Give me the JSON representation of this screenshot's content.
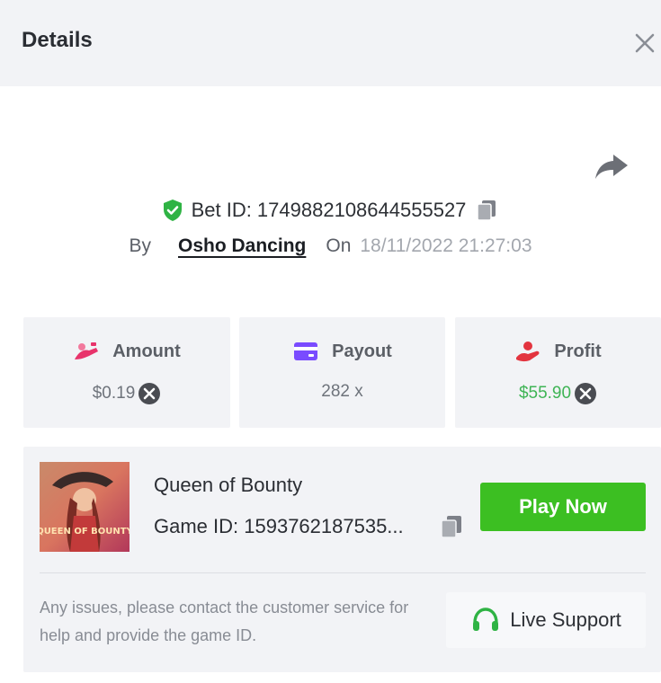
{
  "header": {
    "title": "Details"
  },
  "bet": {
    "id_label": "Bet ID: 1749882108644555527",
    "by_label": "By",
    "user": "Osho Dancing",
    "on_label": "On",
    "datetime": "18/11/2022 21:27:03"
  },
  "stats": [
    {
      "label": "Amount",
      "value": "$0.19",
      "icon": "amount-icon",
      "color": "#e8336b",
      "value_color": "#6e737b"
    },
    {
      "label": "Payout",
      "value": "282 x",
      "icon": "card-icon",
      "color": "#7a4bff",
      "value_color": "#6e737b"
    },
    {
      "label": "Profit",
      "value": "$55.90",
      "icon": "profit-hand-icon",
      "color": "#e3343f",
      "value_color": "#3fb455"
    }
  ],
  "game": {
    "name": "Queen of Bounty",
    "id_label": "Game ID: 1593762187535...",
    "thumb_text": "QUEEN OF BOUNTY",
    "play_label": "Play Now",
    "help_text": "Any issues, please contact the customer service for help and provide the game ID.",
    "support_label": "Live Support",
    "accent": "#3cbf22"
  }
}
